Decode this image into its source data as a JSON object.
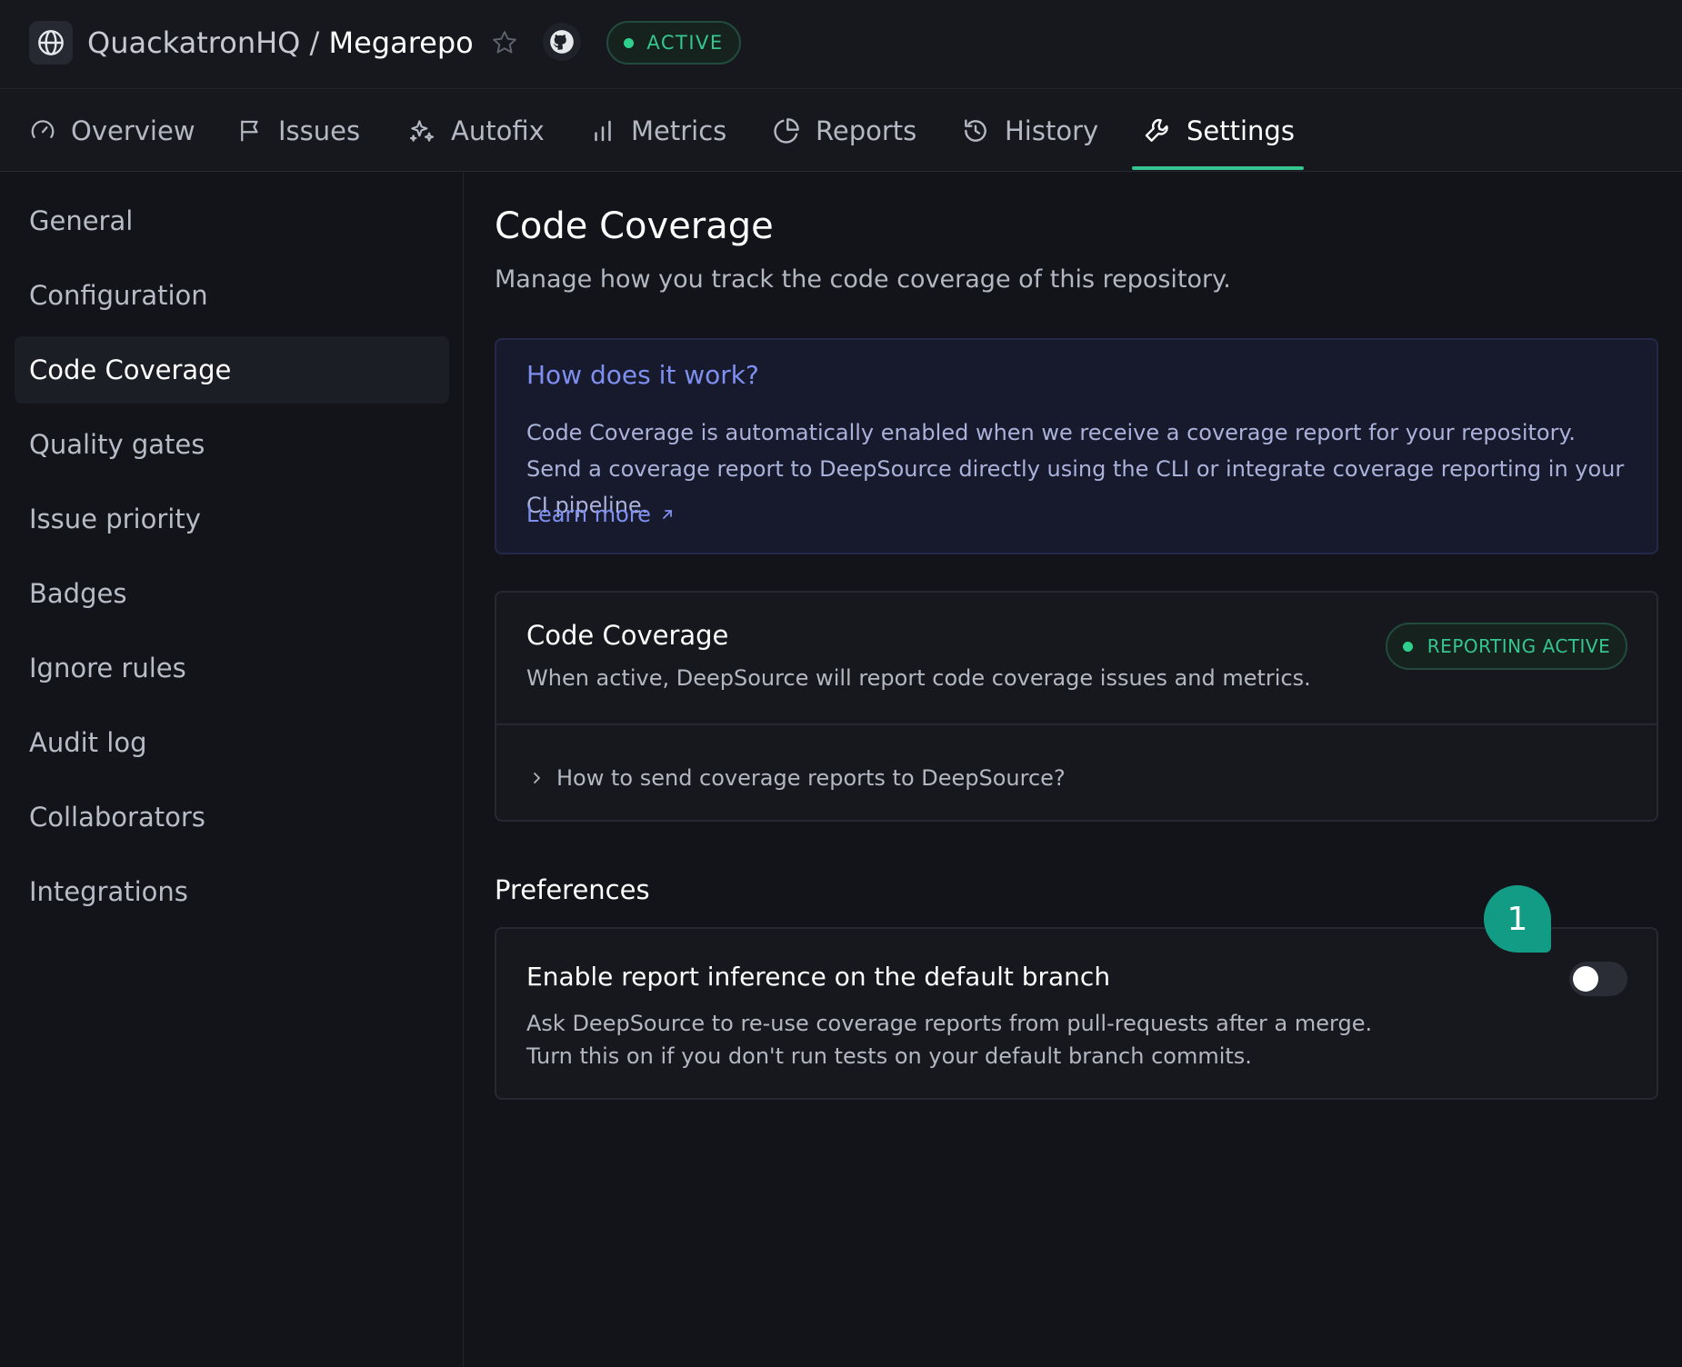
{
  "header": {
    "org": "QuackatronHQ",
    "separator": "/",
    "repo": "Megarepo",
    "status": "ACTIVE",
    "icons": [
      "globe-icon",
      "star-icon",
      "github-icon"
    ]
  },
  "tabs": [
    {
      "label": "Overview",
      "icon": "gauge-icon"
    },
    {
      "label": "Issues",
      "icon": "flag-icon"
    },
    {
      "label": "Autofix",
      "icon": "sparkles-icon"
    },
    {
      "label": "Metrics",
      "icon": "bar-chart-icon"
    },
    {
      "label": "Reports",
      "icon": "pie-chart-icon"
    },
    {
      "label": "History",
      "icon": "history-icon"
    },
    {
      "label": "Settings",
      "icon": "wrench-icon",
      "active": true
    }
  ],
  "sidebar": {
    "items": [
      {
        "label": "General"
      },
      {
        "label": "Configuration"
      },
      {
        "label": "Code Coverage",
        "active": true
      },
      {
        "label": "Quality gates"
      },
      {
        "label": "Issue priority"
      },
      {
        "label": "Badges"
      },
      {
        "label": "Ignore rules"
      },
      {
        "label": "Audit log"
      },
      {
        "label": "Collaborators"
      },
      {
        "label": "Integrations"
      }
    ]
  },
  "main": {
    "title": "Code Coverage",
    "subtitle": "Manage how you track the code coverage of this repository.",
    "info": {
      "title": "How does it work?",
      "text": "Code Coverage is automatically enabled when we receive a coverage report for your repository. Send a coverage report to DeepSource directly using the CLI or integrate coverage reporting in your CI pipeline.",
      "link": "Learn more"
    },
    "coverage_card": {
      "title": "Code Coverage",
      "description": "When active, DeepSource will report code coverage issues and metrics.",
      "badge": "REPORTING ACTIVE",
      "accordion": "How to send coverage reports to DeepSource?"
    },
    "preferences": {
      "heading": "Preferences",
      "item_title": "Enable report inference on the default branch",
      "item_desc_line1": "Ask DeepSource to re-use coverage reports from pull-requests after a merge.",
      "item_desc_line2": "Turn this on if you don't run tests on your default branch commits.",
      "toggle_on": false
    }
  },
  "marker": "1",
  "colors": {
    "accent_green": "#35c690",
    "link_blue": "#7f8ff0",
    "marker_teal": "#129c86",
    "background": "#121419"
  }
}
